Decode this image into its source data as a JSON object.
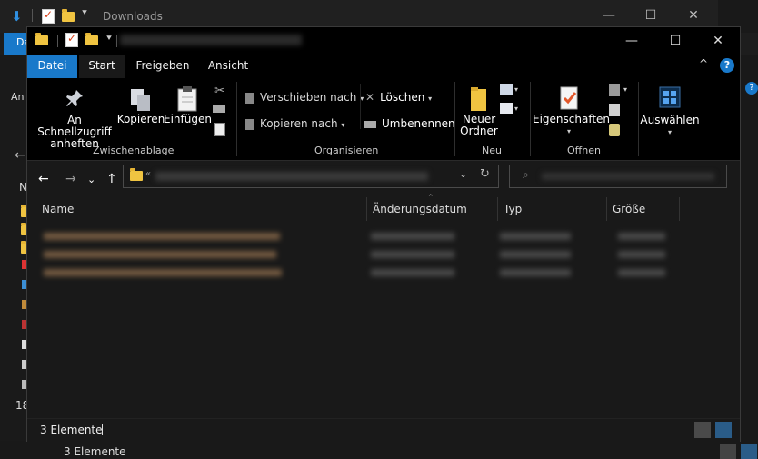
{
  "back_window": {
    "title": "Downloads",
    "datei_tab": "Da",
    "an_label": "An s",
    "n_label": "N",
    "count_label": "18",
    "status": "3 Elemente",
    "controls": {
      "minimize": "—",
      "maximize": "☐",
      "close": "✕"
    },
    "help": "?"
  },
  "window": {
    "controls": {
      "minimize": "—",
      "maximize": "☐",
      "close": "✕"
    },
    "tabs": [
      "Datei",
      "Start",
      "Freigeben",
      "Ansicht"
    ],
    "collapse_symbol": "^",
    "help": "?"
  },
  "ribbon": {
    "zwischenablage": {
      "label": "Zwischenablage",
      "pin": "An Schnellzugriff anheften",
      "copy": "Kopieren",
      "paste": "Einfügen"
    },
    "organisieren": {
      "label": "Organisieren",
      "move": "Verschieben nach",
      "copy_to": "Kopieren nach",
      "delete": "Löschen",
      "rename": "Umbenennen"
    },
    "neu": {
      "label": "Neu",
      "new_folder": "Neuer Ordner"
    },
    "oeffnen": {
      "label": "Öffnen",
      "properties": "Eigenschaften"
    },
    "auswaehlen": {
      "select": "Auswählen"
    }
  },
  "navigation": {
    "back": "←",
    "forward": "→",
    "recent": "⌄",
    "up": "↑",
    "address_prefix": "«",
    "refresh": "↻",
    "dropdown": "⌄"
  },
  "list": {
    "columns": [
      "Name",
      "Änderungsdatum",
      "Typ",
      "Größe"
    ]
  },
  "status": {
    "count": "3 Elemente"
  }
}
